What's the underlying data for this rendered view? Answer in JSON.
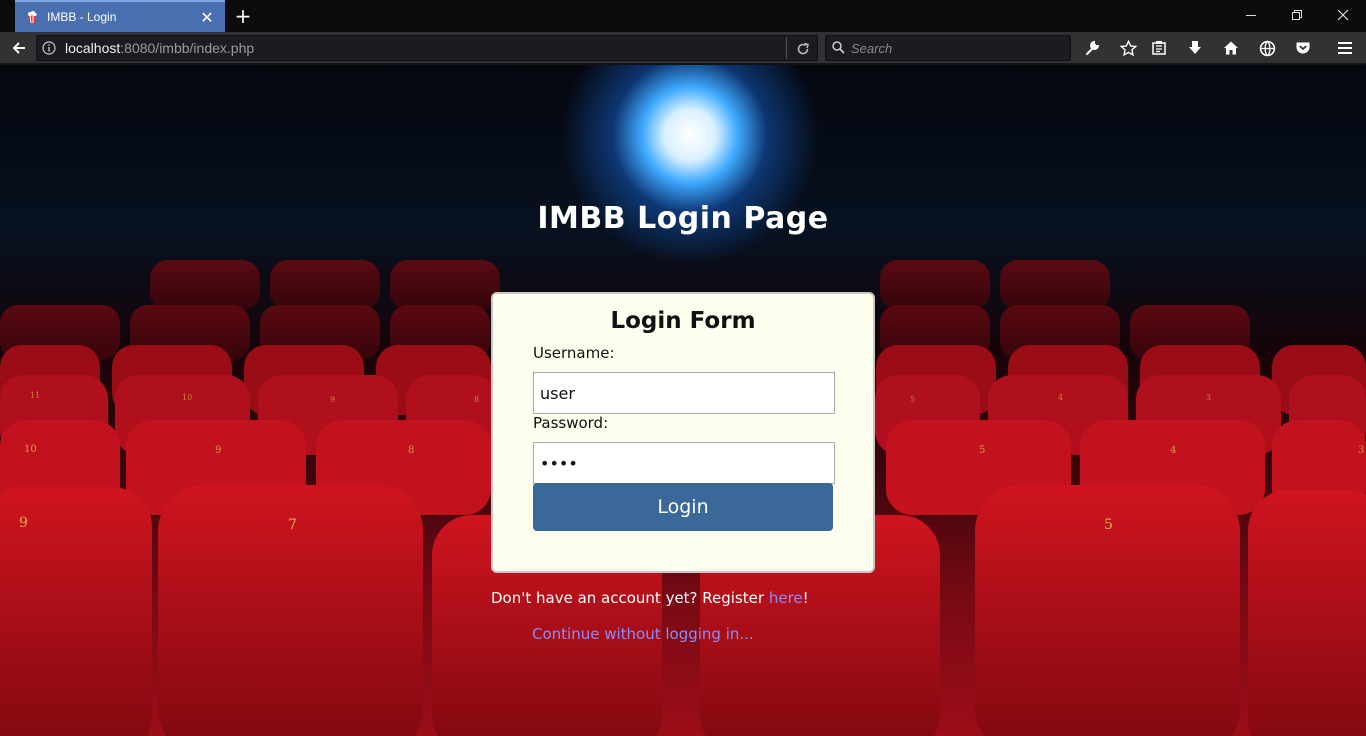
{
  "browser": {
    "tab_title": "IMBB - Login",
    "tab_close": "✕",
    "new_tab": "+",
    "url_host": "localhost",
    "url_path": ":8080/imbb/index.php",
    "search_placeholder": "Search",
    "icons": [
      "back-icon",
      "info-icon",
      "reload-icon",
      "search-icon",
      "wrench-icon",
      "star-icon",
      "reading-list-icon",
      "download-icon",
      "home-icon",
      "extension-icon",
      "pocket-icon",
      "menu-icon"
    ]
  },
  "page": {
    "title": "IMBB Login Page",
    "form": {
      "heading": "Login Form",
      "username_label": "Username:",
      "username_value": "user",
      "password_label": "Password:",
      "password_value": "abcd",
      "login_button": "Login"
    },
    "register_prefix": "Don't have an account yet? Register ",
    "register_link": "here",
    "register_suffix": "!",
    "continue_link": "Continue without logging in..."
  },
  "colors": {
    "tab_active": "#4a6fb0",
    "card_bg": "#fefeef",
    "button": "#3a6899",
    "link": "#8d8cf7",
    "seat_red": "#b3101d"
  }
}
